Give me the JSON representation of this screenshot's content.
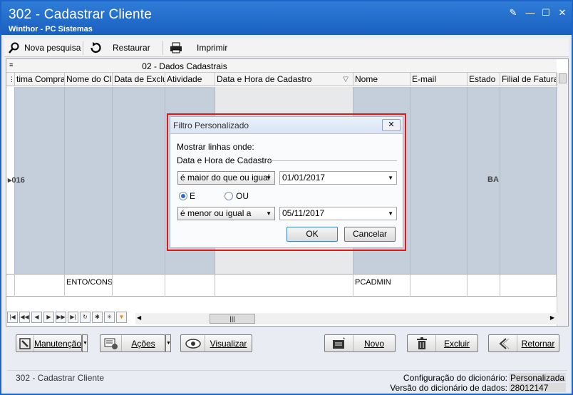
{
  "window": {
    "title": "302 - Cadastrar Cliente",
    "subtitle": "Winthor - PC Sistemas"
  },
  "toolbar": {
    "new_search": "Nova pesquisa",
    "restore": "Restaurar",
    "print": "Imprimir"
  },
  "grid": {
    "band_title": "02 - Dados Cadastrais",
    "columns": [
      "tima Compra",
      "Nome do Clie",
      "Data de Exclus",
      "Atividade",
      "Data e Hora de Cadastro",
      "Nome",
      "E-mail",
      "Estado",
      "Filial de Faturam"
    ],
    "row1": {
      "first_cell": "▸016",
      "estado": "BA"
    },
    "row2": {
      "nome_do_cliente": "ENTO/CONS.",
      "nome": "PCADMIN"
    }
  },
  "filter_dialog": {
    "title": "Filtro Personalizado",
    "show_rows": "Mostrar linhas onde:",
    "field_label": "Data e Hora de Cadastro",
    "condition1": "é maior do que ou igual",
    "value1": "01/01/2017",
    "and_label": "E",
    "or_label": "OU",
    "condition2": "é menor ou igual a",
    "value2": "05/11/2017",
    "ok": "OK",
    "cancel": "Cancelar"
  },
  "actions": {
    "maintenance": "Manutenção",
    "actions": "Ações",
    "view": "Visualizar",
    "new": "Novo",
    "delete": "Excluir",
    "back": "Retornar"
  },
  "status": {
    "left": "302 - Cadastrar Cliente",
    "dict_config_label": "Configuração do dicionário:",
    "dict_config_value": "Personalizada",
    "dict_version_label": "Versão do dicionário de dados:",
    "dict_version_value": "28012147"
  }
}
